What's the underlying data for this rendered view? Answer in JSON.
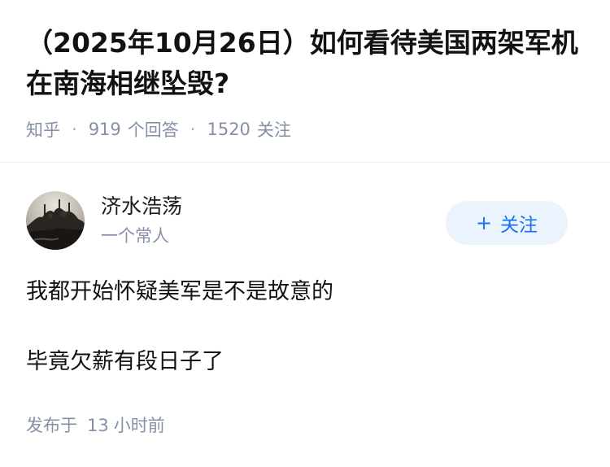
{
  "question": {
    "title": "（2025年10月26日）如何看待美国两架军机在南海相继坠毁?",
    "source": "知乎",
    "answer_count": "919",
    "answer_count_label": "个回答",
    "follower_count": "1520",
    "follower_count_label": "关注",
    "separator": "·"
  },
  "answer": {
    "author": {
      "name": "济水浩荡",
      "bio": "一个常人",
      "avatar_icon": "avatar-photo"
    },
    "follow_button": {
      "icon": "+",
      "label": "关注"
    },
    "content": [
      "我都开始怀疑美军是不是故意的",
      "毕竟欠薪有段日子了"
    ],
    "publish": {
      "prefix": "发布于",
      "value": "13",
      "unit": "小时前"
    }
  },
  "colors": {
    "muted": "#8590a6",
    "accent": "#1772f6",
    "button_bg": "#ebf3fc",
    "text": "#121212"
  }
}
